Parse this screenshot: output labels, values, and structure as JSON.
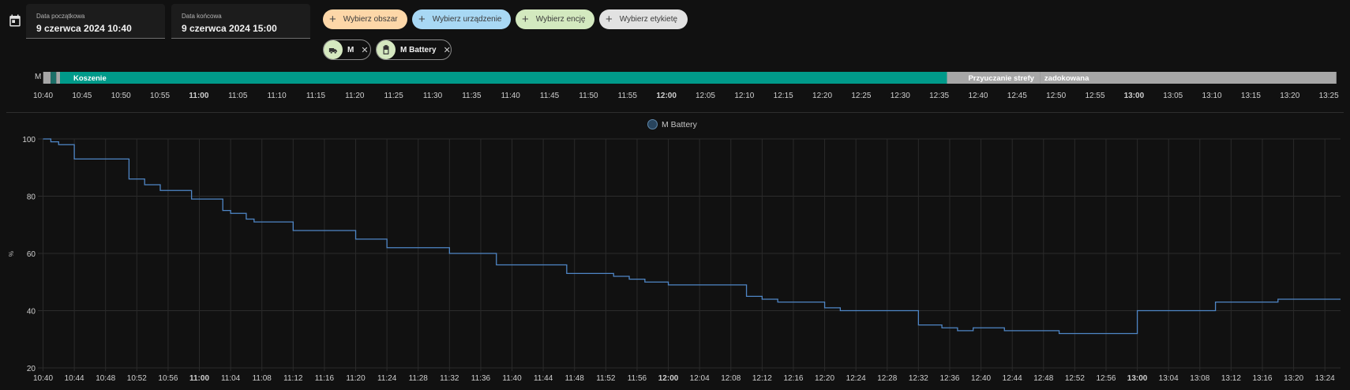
{
  "date_range": {
    "start": {
      "label": "Data początkowa",
      "value": "9 czerwca 2024 10:40"
    },
    "end": {
      "label": "Data końcowa",
      "value": "9 czerwca 2024 15:00"
    }
  },
  "targets": {
    "area": "Wybierz obszar",
    "device": "Wybierz urządzenie",
    "entity": "Wybierz encję",
    "label": "Wybierz etykietę"
  },
  "selected": [
    {
      "name": "M",
      "icon": "robot-mower-icon"
    },
    {
      "name": "M Battery",
      "icon": "battery-icon"
    }
  ],
  "colors": {
    "area_chip": "#fdd7a8",
    "device_chip": "#a8d8f4",
    "entity_chip": "#d3e9bf",
    "label_chip": "#e2e2e2",
    "mowing": "#009a8a",
    "idle": "#a7a7a7",
    "line": "#4f86c6"
  },
  "timeline": {
    "entity_label": "M",
    "range": [
      "10:40",
      "13:26"
    ],
    "segments": [
      {
        "label": "",
        "start": 10.667,
        "end": 10.683,
        "color": "#a7a7a7"
      },
      {
        "label": "",
        "start": 10.683,
        "end": 10.695,
        "color": "#1c6f68"
      },
      {
        "label": "",
        "start": 10.695,
        "end": 10.703,
        "color": "#a7a7a7"
      },
      {
        "label": "Koszenie",
        "start": 10.703,
        "end": 12.6,
        "color": "#009a8a"
      },
      {
        "label": "Przyuczanie strefy",
        "start": 12.6,
        "end": 12.8,
        "color": "#a7a7a7"
      },
      {
        "label": "zadokowana",
        "start": 12.8,
        "end": 13.433,
        "color": "#a7a7a7"
      }
    ],
    "ticks": [
      "10:40",
      "10:45",
      "10:50",
      "10:55",
      "11:00",
      "11:05",
      "11:10",
      "11:15",
      "11:20",
      "11:25",
      "11:30",
      "11:35",
      "11:40",
      "11:45",
      "11:50",
      "11:55",
      "12:00",
      "12:05",
      "12:10",
      "12:15",
      "12:20",
      "12:25",
      "12:30",
      "12:35",
      "12:40",
      "12:45",
      "12:50",
      "12:55",
      "13:00",
      "13:05",
      "13:10",
      "13:15",
      "13:20",
      "13:25"
    ],
    "bold_ticks": [
      "11:00",
      "12:00",
      "13:00"
    ]
  },
  "chart_data": {
    "type": "line",
    "series": [
      {
        "name": "M Battery",
        "step": true,
        "points": [
          [
            "10:40",
            100
          ],
          [
            "10:41",
            99
          ],
          [
            "10:42",
            98
          ],
          [
            "10:44",
            93
          ],
          [
            "10:51",
            86
          ],
          [
            "10:53",
            84
          ],
          [
            "10:55",
            82
          ],
          [
            "10:59",
            79
          ],
          [
            "11:03",
            75
          ],
          [
            "11:04",
            74
          ],
          [
            "11:06",
            72
          ],
          [
            "11:07",
            71
          ],
          [
            "11:12",
            68
          ],
          [
            "11:20",
            65
          ],
          [
            "11:24",
            62
          ],
          [
            "11:32",
            60
          ],
          [
            "11:38",
            56
          ],
          [
            "11:47",
            53
          ],
          [
            "11:53",
            52
          ],
          [
            "11:55",
            51
          ],
          [
            "11:57",
            50
          ],
          [
            "12:00",
            49
          ],
          [
            "12:10",
            45
          ],
          [
            "12:12",
            44
          ],
          [
            "12:14",
            43
          ],
          [
            "12:20",
            41
          ],
          [
            "12:22",
            40
          ],
          [
            "12:32",
            35
          ],
          [
            "12:35",
            34
          ],
          [
            "12:37",
            33
          ],
          [
            "12:39",
            34
          ],
          [
            "12:43",
            33
          ],
          [
            "12:50",
            32
          ],
          [
            "13:00",
            40
          ],
          [
            "13:10",
            43
          ],
          [
            "13:18",
            44
          ],
          [
            "13:26",
            44
          ]
        ]
      }
    ],
    "x_range": [
      "10:40",
      "13:26"
    ],
    "ylim": [
      20,
      100
    ],
    "yticks": [
      20,
      40,
      60,
      80,
      100
    ],
    "ylabel": "%",
    "xticks": [
      "10:40",
      "10:44",
      "10:48",
      "10:52",
      "10:56",
      "11:00",
      "11:04",
      "11:08",
      "11:12",
      "11:16",
      "11:20",
      "11:24",
      "11:28",
      "11:32",
      "11:36",
      "11:40",
      "11:44",
      "11:48",
      "11:52",
      "11:56",
      "12:00",
      "12:04",
      "12:08",
      "12:12",
      "12:16",
      "12:20",
      "12:24",
      "12:28",
      "12:32",
      "12:36",
      "12:40",
      "12:44",
      "12:48",
      "12:52",
      "12:56",
      "13:00",
      "13:04",
      "13:08",
      "13:12",
      "13:16",
      "13:20",
      "13:24"
    ],
    "bold_xticks": [
      "11:00",
      "12:00",
      "13:00"
    ],
    "legend": "top-center",
    "grid": true
  }
}
